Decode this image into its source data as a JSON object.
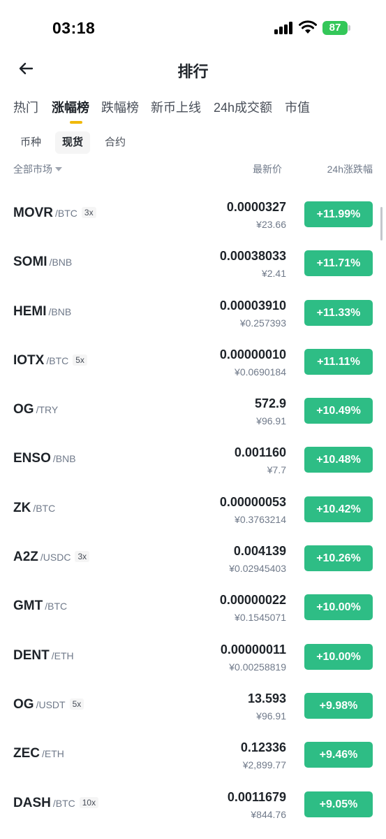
{
  "status": {
    "time": "03:18",
    "battery": "87"
  },
  "nav": {
    "title": "排行"
  },
  "tabs": [
    {
      "label": "热门",
      "active": false
    },
    {
      "label": "涨幅榜",
      "active": true
    },
    {
      "label": "跌幅榜",
      "active": false
    },
    {
      "label": "新币上线",
      "active": false
    },
    {
      "label": "24h成交额",
      "active": false
    },
    {
      "label": "市值",
      "active": false
    }
  ],
  "subtabs": [
    {
      "label": "币种",
      "active": false
    },
    {
      "label": "现货",
      "active": true
    },
    {
      "label": "合约",
      "active": false
    }
  ],
  "list_header": {
    "market": "全部市场",
    "price": "最新价",
    "change": "24h涨跌幅"
  },
  "rows": [
    {
      "base": "MOVR",
      "quote": "/BTC",
      "leverage": "3x",
      "price": "0.0000327",
      "fiat": "¥23.66",
      "change": "+11.99%"
    },
    {
      "base": "SOMI",
      "quote": "/BNB",
      "leverage": "",
      "price": "0.00038033",
      "fiat": "¥2.41",
      "change": "+11.71%"
    },
    {
      "base": "HEMI",
      "quote": "/BNB",
      "leverage": "",
      "price": "0.00003910",
      "fiat": "¥0.257393",
      "change": "+11.33%"
    },
    {
      "base": "IOTX",
      "quote": "/BTC",
      "leverage": "5x",
      "price": "0.00000010",
      "fiat": "¥0.0690184",
      "change": "+11.11%"
    },
    {
      "base": "OG",
      "quote": "/TRY",
      "leverage": "",
      "price": "572.9",
      "fiat": "¥96.91",
      "change": "+10.49%"
    },
    {
      "base": "ENSO",
      "quote": "/BNB",
      "leverage": "",
      "price": "0.001160",
      "fiat": "¥7.7",
      "change": "+10.48%"
    },
    {
      "base": "ZK",
      "quote": "/BTC",
      "leverage": "",
      "price": "0.00000053",
      "fiat": "¥0.3763214",
      "change": "+10.42%"
    },
    {
      "base": "A2Z",
      "quote": "/USDC",
      "leverage": "3x",
      "price": "0.004139",
      "fiat": "¥0.02945403",
      "change": "+10.26%"
    },
    {
      "base": "GMT",
      "quote": "/BTC",
      "leverage": "",
      "price": "0.00000022",
      "fiat": "¥0.1545071",
      "change": "+10.00%"
    },
    {
      "base": "DENT",
      "quote": "/ETH",
      "leverage": "",
      "price": "0.00000011",
      "fiat": "¥0.00258819",
      "change": "+10.00%"
    },
    {
      "base": "OG",
      "quote": "/USDT",
      "leverage": "5x",
      "price": "13.593",
      "fiat": "¥96.91",
      "change": "+9.98%"
    },
    {
      "base": "ZEC",
      "quote": "/ETH",
      "leverage": "",
      "price": "0.12336",
      "fiat": "¥2,899.77",
      "change": "+9.46%"
    },
    {
      "base": "DASH",
      "quote": "/BTC",
      "leverage": "10x",
      "price": "0.0011679",
      "fiat": "¥844.76",
      "change": "+9.05%"
    }
  ],
  "colors": {
    "positive": "#2ebd85",
    "accent": "#f0b90b",
    "text_primary": "#1e2329",
    "text_secondary": "#707a8a"
  },
  "icons": {
    "back": "arrow-left-icon",
    "signal": "cellular-signal-icon",
    "wifi": "wifi-icon",
    "battery": "battery-icon",
    "caret": "caret-down-icon"
  }
}
